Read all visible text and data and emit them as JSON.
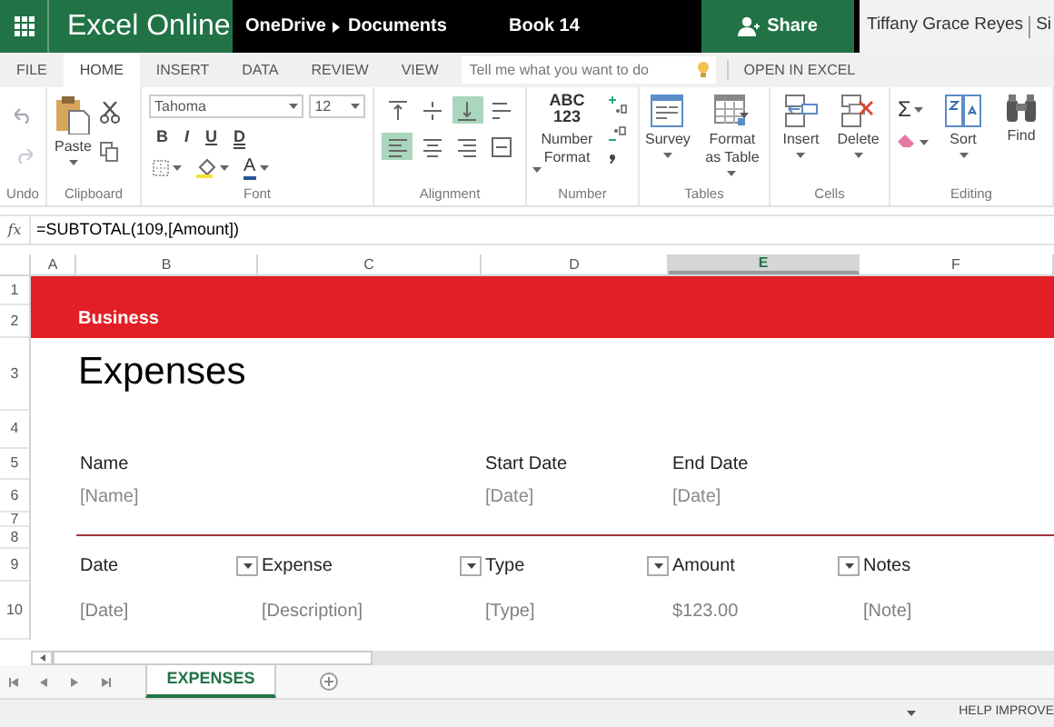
{
  "app_bar": {
    "app_name": "Excel Online",
    "breadcrumb": [
      "OneDrive",
      "Documents"
    ],
    "document_title": "Book 14",
    "share_button": "Share",
    "user_name": "Tiffany Grace Reyes",
    "cut_text": "Si"
  },
  "ribbon_tabs": [
    {
      "label": "FILE",
      "selected": false
    },
    {
      "label": "HOME",
      "selected": true
    },
    {
      "label": "INSERT",
      "selected": false
    },
    {
      "label": "DATA",
      "selected": false
    },
    {
      "label": "REVIEW",
      "selected": false
    },
    {
      "label": "VIEW",
      "selected": false
    }
  ],
  "tell_me": {
    "placeholder": "Tell me what you want to do"
  },
  "open_in_excel": "OPEN IN EXCEL",
  "ribbon": {
    "undo": {
      "label": "Undo"
    },
    "clipboard": {
      "label": "Clipboard",
      "paste": "Paste"
    },
    "font": {
      "label": "Font",
      "font_name": "Tahoma",
      "font_size": "12",
      "styles": [
        "B",
        "I",
        "U",
        "D"
      ],
      "font_color": "A"
    },
    "alignment": {
      "label": "Alignment",
      "buttons": [
        {
          "selected": false
        },
        {
          "selected": false
        },
        {
          "selected": true
        },
        {
          "selected": false
        },
        {
          "selected": true
        },
        {
          "selected": false
        },
        {
          "selected": false
        },
        {
          "selected": false
        }
      ]
    },
    "number": {
      "label": "Number",
      "icon_text": [
        "ABC",
        "123"
      ],
      "button": "Number Format"
    },
    "tables": {
      "label": "Tables",
      "buttons": [
        "Survey",
        "Format as Table"
      ]
    },
    "cells": {
      "label": "Cells",
      "buttons": [
        "Insert",
        "Delete"
      ]
    },
    "editing": {
      "label": "Editing",
      "autosum": "Σ",
      "buttons": [
        "Sort",
        "Find"
      ]
    }
  },
  "formula_bar": {
    "function_button": "fx",
    "formula": "=SUBTOTAL(109,[Amount])"
  },
  "columns": [
    {
      "label": "A",
      "selected": false
    },
    {
      "label": "B",
      "selected": false
    },
    {
      "label": "C",
      "selected": false
    },
    {
      "label": "D",
      "selected": false
    },
    {
      "label": "E",
      "selected": true
    },
    {
      "label": "F",
      "selected": false
    }
  ],
  "row_numbers": [
    "1",
    "2",
    "3",
    "4",
    "5",
    "6",
    "7",
    "8",
    "9",
    "10"
  ],
  "sheet": {
    "band_label": "Business",
    "title": "Expenses",
    "fields": [
      {
        "label": "Name",
        "value": "[Name]"
      },
      {
        "label": "Start Date",
        "value": "[Date]"
      },
      {
        "label": "End Date",
        "value": "[Date]"
      }
    ],
    "table": {
      "columns": [
        {
          "label": "Date",
          "filter_button": true
        },
        {
          "label": "Expense",
          "filter_button": true
        },
        {
          "label": "Type",
          "filter_button": true
        },
        {
          "label": "Amount",
          "filter_button": true
        },
        {
          "label": "Notes",
          "filter_button": false
        }
      ],
      "rows": [
        [
          "[Date]",
          "[Description]",
          "[Type]",
          "$123.00",
          "[Note]"
        ]
      ]
    }
  },
  "sheet_tabs": [
    {
      "label": "EXPENSES",
      "selected": true
    }
  ],
  "status_bar": {
    "help_text": "HELP IMPROVE"
  }
}
